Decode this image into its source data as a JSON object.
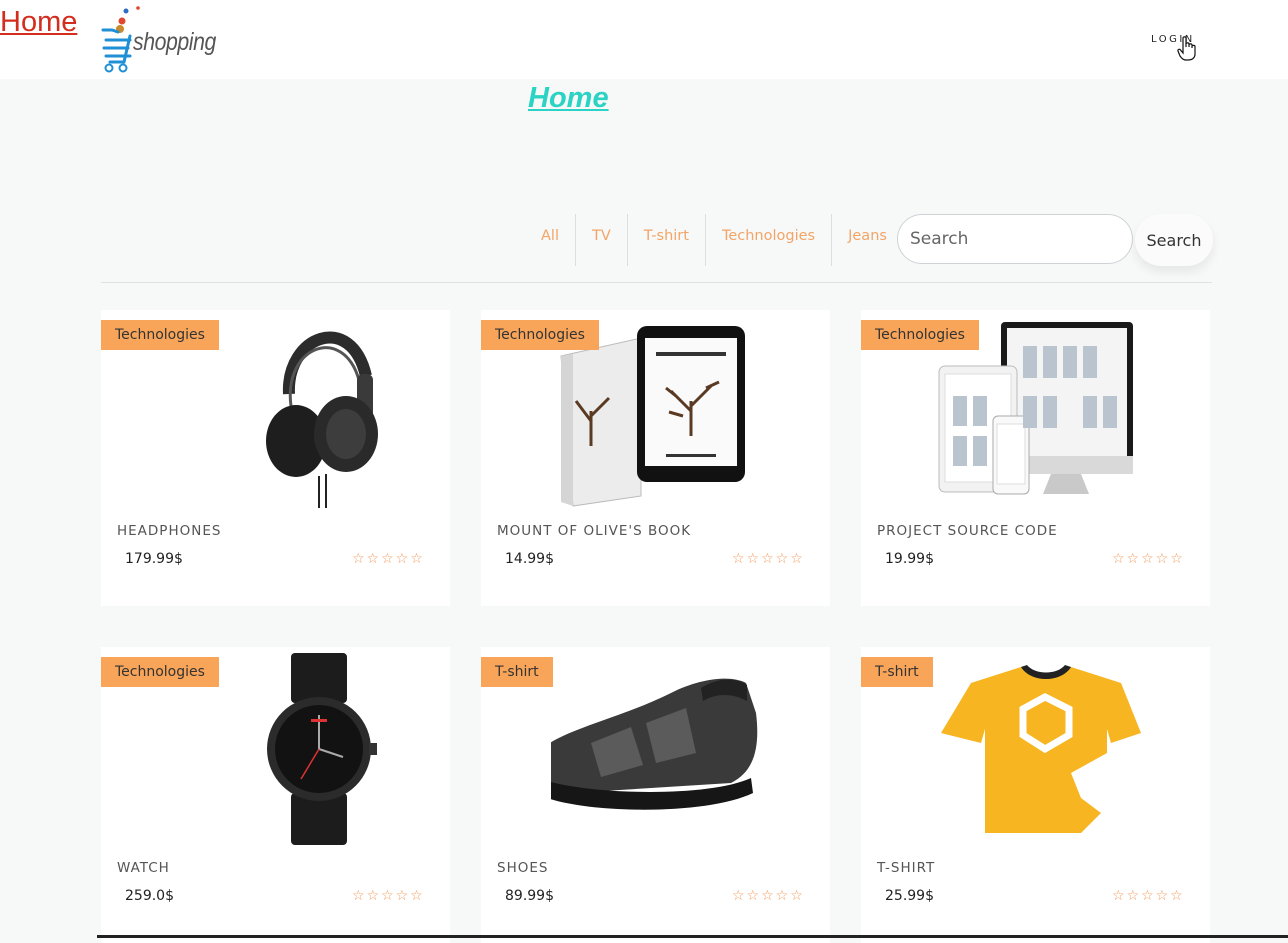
{
  "header": {
    "home_link": "Home",
    "logo_text": "shopping",
    "login_label": "LOGIN"
  },
  "page": {
    "heading": "Home"
  },
  "filters": [
    "All",
    "TV",
    "T-shirt",
    "Technologies",
    "Jeans"
  ],
  "search": {
    "placeholder": "Search",
    "button_label": "Search"
  },
  "products": [
    {
      "category": "Technologies",
      "name": "HEADPHONES",
      "price": "179.99$",
      "rating": "☆☆☆☆☆",
      "image": "headphones-image"
    },
    {
      "category": "Technologies",
      "name": "MOUNT OF OLIVE'S BOOK",
      "price": "14.99$",
      "rating": "☆☆☆☆☆",
      "image": "book-tablet-image"
    },
    {
      "category": "Technologies",
      "name": "PROJECT SOURCE CODE",
      "price": "19.99$",
      "rating": "☆☆☆☆☆",
      "image": "devices-image"
    },
    {
      "category": "Technologies",
      "name": "WATCH",
      "price": "259.0$",
      "rating": "☆☆☆☆☆",
      "image": "watch-image"
    },
    {
      "category": "T-shirt",
      "name": "SHOES",
      "price": "89.99$",
      "rating": "☆☆☆☆☆",
      "image": "shoe-image"
    },
    {
      "category": "T-shirt",
      "name": "T-SHIRT",
      "price": "25.99$",
      "rating": "☆☆☆☆☆",
      "image": "tshirt-image"
    }
  ],
  "colors": {
    "home_link": "#d22d1d",
    "heading": "#2ad3c3",
    "accent": "#f8a55a",
    "filter_text": "#f2a567",
    "stars": "#f39a5c"
  }
}
